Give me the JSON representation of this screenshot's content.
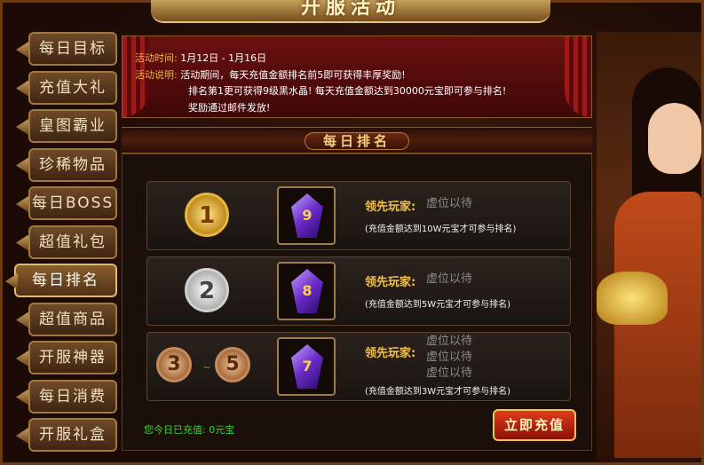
{
  "title": "开服活动",
  "sidebar": {
    "items": [
      {
        "label": "每日目标"
      },
      {
        "label": "充值大礼"
      },
      {
        "label": "皇图霸业"
      },
      {
        "label": "珍稀物品"
      },
      {
        "label": "每日BOSS"
      },
      {
        "label": "超值礼包"
      },
      {
        "label": "每日排名"
      },
      {
        "label": "超值商品"
      },
      {
        "label": "开服神器"
      },
      {
        "label": "每日消费"
      },
      {
        "label": "开服礼盒"
      }
    ],
    "active_index": 6
  },
  "notice": {
    "time_label": "活动时间:",
    "time_value": "1月12日 - 1月16日",
    "desc_label": "活动说明:",
    "desc_line1": "活动期间，每天充值金额排名前5即可获得丰厚奖励!",
    "desc_line2": "排名第1更可获得9级黑水晶! 每天充值金额达到30000元宝即可参与排名!",
    "desc_line3": "奖励通过邮件发放!"
  },
  "section_title": "每日排名",
  "ranks": [
    {
      "medal": "1",
      "gem_level": "9",
      "leader_label": "领先玩家:",
      "leaders": [
        "虚位以待"
      ],
      "requirement": "(充值金额达到10W元宝才可参与排名)"
    },
    {
      "medal": "2",
      "gem_level": "8",
      "leader_label": "领先玩家:",
      "leaders": [
        "虚位以待"
      ],
      "requirement": "(充值金额达到5W元宝才可参与排名)"
    },
    {
      "medal_from": "3",
      "medal_to": "5",
      "range_separator": "~",
      "gem_level": "7",
      "leader_label": "领先玩家:",
      "leaders": [
        "虚位以待",
        "虚位以待",
        "虚位以待"
      ],
      "requirement": "(充值金额达到3W元宝才可参与排名)"
    }
  ],
  "today_recharge": "您今日已充值: 0元宝",
  "recharge_button": "立即充值"
}
